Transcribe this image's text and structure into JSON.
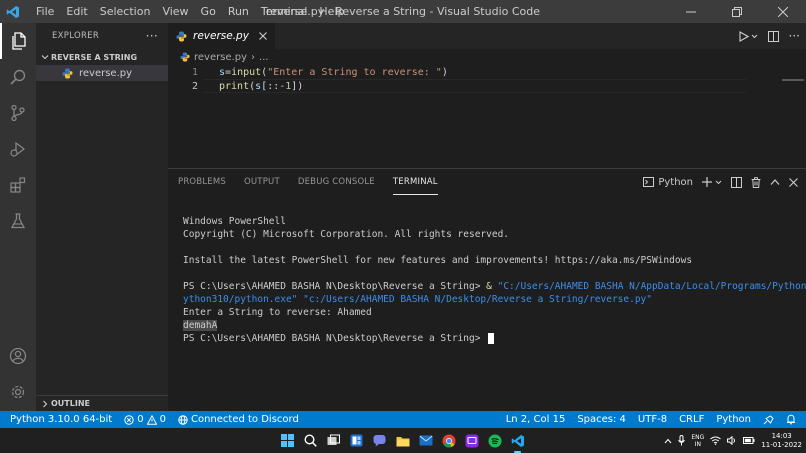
{
  "window": {
    "title": "reverse.py - Reverse a String - Visual Studio Code",
    "menu": [
      "File",
      "Edit",
      "Selection",
      "View",
      "Go",
      "Run",
      "Terminal",
      "Help"
    ]
  },
  "sidebar": {
    "header": "EXPLORER",
    "folder": "REVERSE A STRING",
    "files": [
      "reverse.py"
    ],
    "outline": "OUTLINE"
  },
  "editor": {
    "tab": "reverse.py",
    "breadcrumb": [
      "reverse.py",
      "..."
    ],
    "lines": [
      {
        "number": "1",
        "segments": [
          {
            "t": "s",
            "c": "var"
          },
          {
            "t": "=",
            "c": "plain"
          },
          {
            "t": "input",
            "c": "fn"
          },
          {
            "t": "(",
            "c": "plain"
          },
          {
            "t": "\"Enter a String to reverse: \"",
            "c": "str"
          },
          {
            "t": ")",
            "c": "plain"
          }
        ]
      },
      {
        "number": "2",
        "segments": [
          {
            "t": "print",
            "c": "fn"
          },
          {
            "t": "(",
            "c": "plain"
          },
          {
            "t": "s",
            "c": "var"
          },
          {
            "t": "[::",
            "c": "plain"
          },
          {
            "t": "-1",
            "c": "num"
          },
          {
            "t": "])",
            "c": "plain"
          }
        ]
      }
    ]
  },
  "panel": {
    "tabs": [
      "PROBLEMS",
      "OUTPUT",
      "DEBUG CONSOLE",
      "TERMINAL"
    ],
    "active_tab": "TERMINAL",
    "terminal_name": "Python",
    "terminal": {
      "l1": "Windows PowerShell",
      "l2": "Copyright (C) Microsoft Corporation. All rights reserved.",
      "l3": "Install the latest PowerShell for new features and improvements! https://aka.ms/PSWindows",
      "prompt1": "PS C:\\Users\\AHAMED BASHA N\\Desktop\\Reverse a String> ",
      "cmd_amp": "& ",
      "cmd_arg1_a": "\"C:/Users/AHAMED BASHA N/AppData/Local/Programs/Python/P",
      "cmd_arg1_b": "ython310/python.exe\"",
      "cmd_arg2": " \"c:/Users/AHAMED BASHA N/Desktop/Reverse a String/reverse.py\"",
      "l5": "Enter a String to reverse: Ahamed",
      "l6": "demahA",
      "prompt2": "PS C:\\Users\\AHAMED BASHA N\\Desktop\\Reverse a String> "
    }
  },
  "statusbar": {
    "python": "Python 3.10.0 64-bit",
    "errors": "0",
    "warnings": "0",
    "discord": "Connected to Discord",
    "position": "Ln 2, Col 15",
    "spaces": "Spaces: 4",
    "encoding": "UTF-8",
    "eol": "CRLF",
    "language": "Python"
  },
  "taskbar": {
    "lang_top": "ENG",
    "lang_bottom": "IN",
    "time": "14:03",
    "date": "11-01-2022"
  },
  "colors": {
    "accent": "#007acc",
    "titlebar": "#3c3c3c",
    "activitybar": "#333333",
    "sidebar": "#252526",
    "editor": "#1e1e1e"
  }
}
